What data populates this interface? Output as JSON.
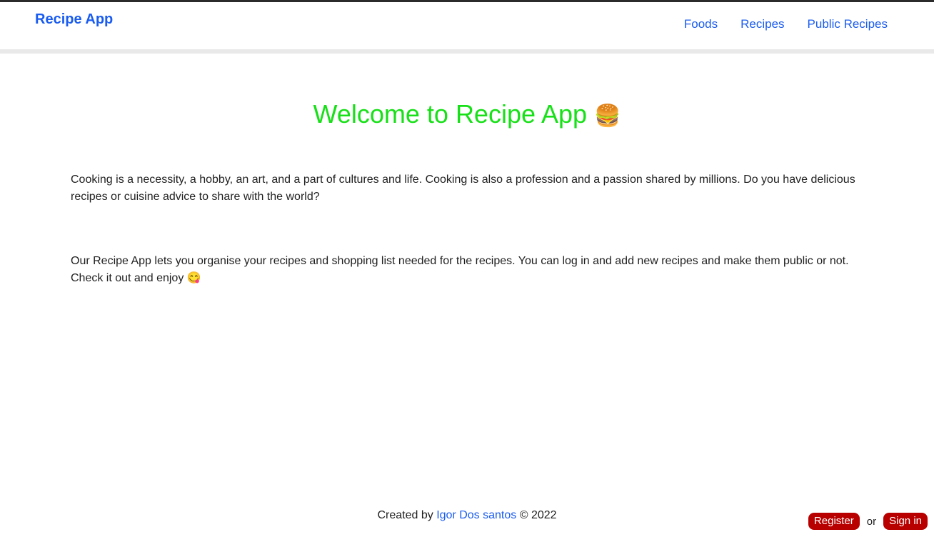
{
  "navbar": {
    "brand": "Recipe App",
    "links": [
      {
        "label": "Foods"
      },
      {
        "label": "Recipes"
      },
      {
        "label": "Public Recipes"
      }
    ]
  },
  "hero": {
    "title": "Welcome to Recipe App",
    "title_emoji": "🍔"
  },
  "content": {
    "paragraph_1": "Cooking is a necessity, a hobby, an art, and a part of cultures and life. Cooking is also a profession and a passion shared by millions. Do you have delicious recipes or cuisine advice to share with the world?",
    "paragraph_2": "Our Recipe App lets you organise your recipes and shopping list needed for the recipes. You can log in and add new recipes and make them public or not. Check it out and enjoy",
    "paragraph_2_emoji": "😋"
  },
  "footer": {
    "created_by": "Created by",
    "author": "Igor Dos santos",
    "copyright": "© 2022"
  },
  "auth": {
    "register_label": "Register",
    "or_label": "or",
    "signin_label": "Sign in"
  },
  "colors": {
    "link": "#1a5cf0",
    "hero_title": "#18e018",
    "auth_button": "#b80000"
  }
}
